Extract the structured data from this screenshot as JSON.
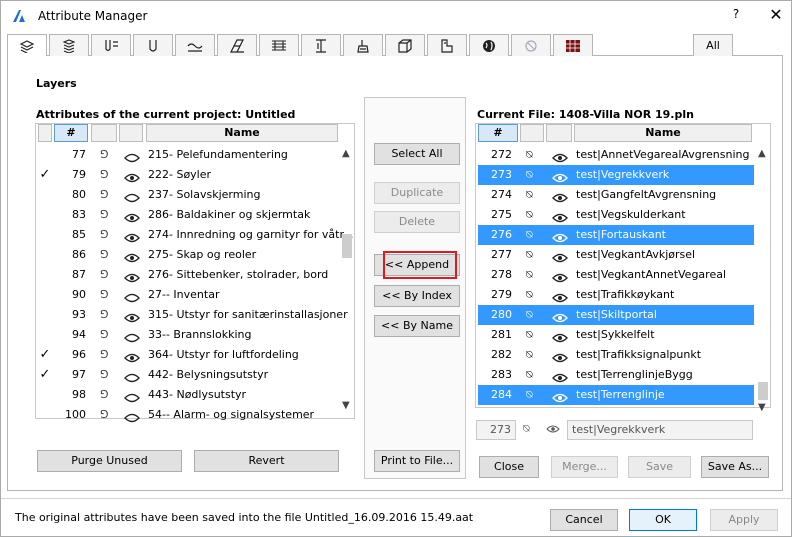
{
  "window": {
    "title": "Attribute Manager",
    "help": "?",
    "close": "✕"
  },
  "tabs": [
    {
      "icon": "layers-icon"
    },
    {
      "icon": "layer-combinations-icon"
    },
    {
      "icon": "pens-icon"
    },
    {
      "icon": "line-types-icon"
    },
    {
      "icon": "fill-types-icon"
    },
    {
      "icon": "composites-icon"
    },
    {
      "icon": "profiles-icon"
    },
    {
      "icon": "zones-icon"
    },
    {
      "icon": "surfaces-icon"
    },
    {
      "icon": "materials-icon"
    },
    {
      "icon": "mep-systems-icon"
    },
    {
      "icon": "markup-styles-icon"
    },
    {
      "icon": "operation-profiles-icon"
    },
    {
      "icon": "building-materials-icon"
    }
  ],
  "tab_all": "All",
  "section": "Layers",
  "left": {
    "label": "Attributes of the current project: Untitled",
    "headers": {
      "num": "#",
      "name": "Name"
    },
    "rows": [
      {
        "check": "",
        "num": "77",
        "lock": "⅁",
        "eye": "closed",
        "name": "215- Pelefundamentering"
      },
      {
        "check": "✓",
        "num": "79",
        "lock": "⅁",
        "eye": "open",
        "name": "222- Søyler"
      },
      {
        "check": "",
        "num": "80",
        "lock": "⅁",
        "eye": "closed",
        "name": "237- Solavskjerming"
      },
      {
        "check": "",
        "num": "83",
        "lock": "⅁",
        "eye": "open",
        "name": "286- Baldakiner og skjermtak"
      },
      {
        "check": "",
        "num": "85",
        "lock": "⅁",
        "eye": "open",
        "name": "274- Innredning og garnityr for våtr..."
      },
      {
        "check": "",
        "num": "86",
        "lock": "⅁",
        "eye": "open",
        "name": "275- Skap og reoler"
      },
      {
        "check": "",
        "num": "87",
        "lock": "⅁",
        "eye": "open",
        "name": "276- Sittebenker, stolrader, bord"
      },
      {
        "check": "",
        "num": "90",
        "lock": "⅁",
        "eye": "closed",
        "name": "27-- Inventar"
      },
      {
        "check": "",
        "num": "93",
        "lock": "⅁",
        "eye": "open",
        "name": "315- Utstyr for sanitærinstallasjoner"
      },
      {
        "check": "",
        "num": "94",
        "lock": "⅁",
        "eye": "closed",
        "name": "33-- Brannslokking"
      },
      {
        "check": "✓",
        "num": "96",
        "lock": "⅁",
        "eye": "open",
        "name": "364- Utstyr for luftfordeling"
      },
      {
        "check": "✓",
        "num": "97",
        "lock": "⅁",
        "eye": "closed",
        "name": "442- Belysningsutstyr"
      },
      {
        "check": "",
        "num": "98",
        "lock": "⅁",
        "eye": "closed",
        "name": "443- Nødlysutstyr"
      },
      {
        "check": "",
        "num": "100",
        "lock": "⅁",
        "eye": "closed",
        "name": "54-- Alarm- og signalsystemer"
      }
    ],
    "purge": "Purge Unused",
    "revert": "Revert"
  },
  "middle": {
    "select_all": "Select All",
    "duplicate": "Duplicate",
    "delete": "Delete",
    "append": "<< Append",
    "by_index": "<< By Index",
    "by_name": "<< By Name",
    "print": "Print to File..."
  },
  "right": {
    "label": "Current File: 1408-Villa NOR 19.pln",
    "headers": {
      "num": "#",
      "name": "Name"
    },
    "rows": [
      {
        "num": "272",
        "lock": "⍉",
        "eye": "open",
        "name": "test|AnnetVegarealAvgrensning",
        "hl": false
      },
      {
        "num": "273",
        "lock": "⍉",
        "eye": "open",
        "name": "test|Vegrekkverk",
        "hl": true
      },
      {
        "num": "274",
        "lock": "⍉",
        "eye": "open",
        "name": "test|GangfeltAvgrensning",
        "hl": false
      },
      {
        "num": "275",
        "lock": "⍉",
        "eye": "open",
        "name": "test|Vegskulderkant",
        "hl": false
      },
      {
        "num": "276",
        "lock": "⍉",
        "eye": "open",
        "name": "test|Fortauskant",
        "hl": true
      },
      {
        "num": "277",
        "lock": "⍉",
        "eye": "open",
        "name": "test|VegkantAvkjørsel",
        "hl": false
      },
      {
        "num": "278",
        "lock": "⍉",
        "eye": "open",
        "name": "test|VegkantAnnetVegareal",
        "hl": false
      },
      {
        "num": "279",
        "lock": "⍉",
        "eye": "open",
        "name": "test|Trafikkøykant",
        "hl": false
      },
      {
        "num": "280",
        "lock": "⍉",
        "eye": "open",
        "name": "test|Skiltportal",
        "hl": true
      },
      {
        "num": "281",
        "lock": "⍉",
        "eye": "open",
        "name": "test|Sykkelfelt",
        "hl": false
      },
      {
        "num": "282",
        "lock": "⍉",
        "eye": "open",
        "name": "test|Trafikksignalpunkt",
        "hl": false
      },
      {
        "num": "283",
        "lock": "⍉",
        "eye": "open",
        "name": "test|TerrenglinjeBygg",
        "hl": false
      },
      {
        "num": "284",
        "lock": "⍉",
        "eye": "open",
        "name": "test|Terrenglinje",
        "hl": true
      }
    ],
    "edit": {
      "num": "273",
      "name": "test|Vegrekkverk"
    },
    "close": "Close",
    "merge": "Merge...",
    "save": "Save",
    "save_as": "Save As..."
  },
  "status": "The original attributes have been saved into the file Untitled_16.09.2016 15.49.aat",
  "dialog": {
    "cancel": "Cancel",
    "ok": "OK",
    "apply": "Apply"
  },
  "colors": {
    "selection": "#3399ff",
    "highlight_border": "#e0191d",
    "accent": "#0078d7"
  }
}
